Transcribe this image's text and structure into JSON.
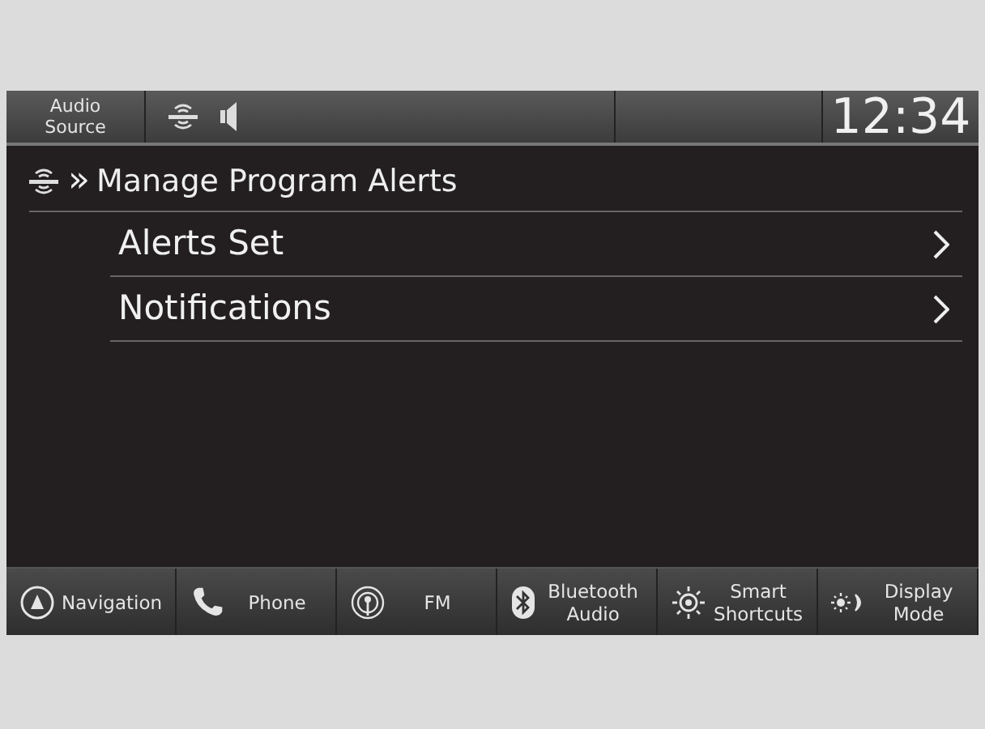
{
  "top_bar": {
    "source_button": "Audio Source",
    "clock": "12:34"
  },
  "header": {
    "separator": "»",
    "title": "Manage Program Alerts"
  },
  "menu_items": [
    {
      "label": "Alerts Set"
    },
    {
      "label": "Notifications"
    }
  ],
  "bottom_bar": [
    {
      "kind": "navigation",
      "label": "Navigation"
    },
    {
      "kind": "phone",
      "label": "Phone"
    },
    {
      "kind": "fm",
      "label": "FM"
    },
    {
      "kind": "bluetooth",
      "label": "Bluetooth Audio"
    },
    {
      "kind": "shortcuts",
      "label": "Smart Shortcuts"
    },
    {
      "kind": "display",
      "label": "Display Mode"
    }
  ]
}
